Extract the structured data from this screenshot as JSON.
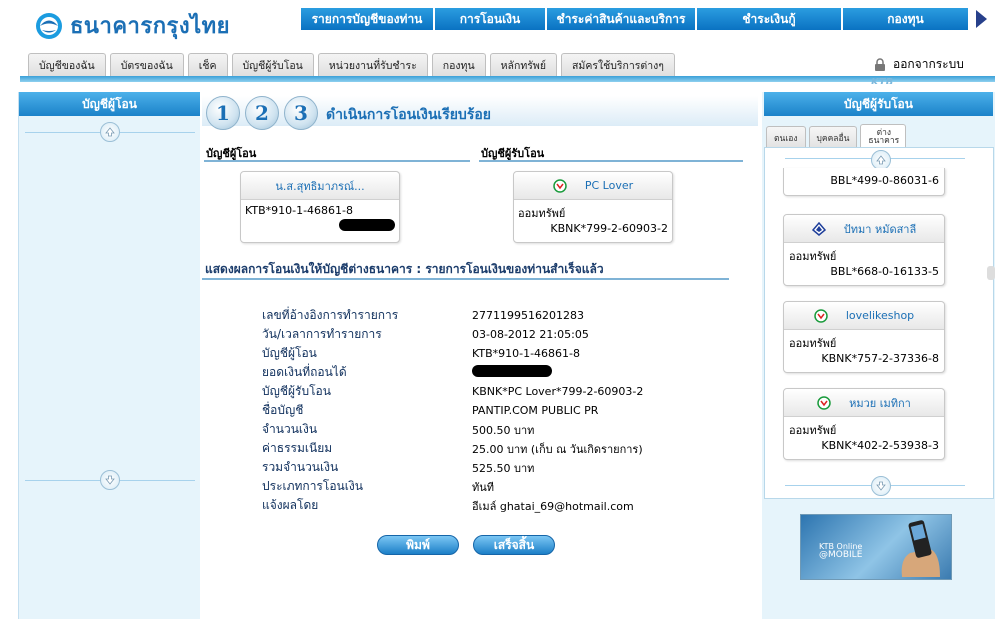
{
  "brand": {
    "name": "ธนาคารกรุงไทย"
  },
  "topnav": [
    {
      "label": "รายการบัญชีของท่าน",
      "width": 134
    },
    {
      "label": "การโอนเงิน",
      "width": 112
    },
    {
      "label": "ชำระค่าสินค้าและบริการ",
      "width": 150
    },
    {
      "label": "ชำระเงินกู้",
      "width": 146
    },
    {
      "label": "กองทุน",
      "width": 127
    }
  ],
  "subtabs": [
    "บัญชีของฉัน",
    "บัตรของฉัน",
    "เช็ค",
    "บัญชีผู้รับโอน",
    "หน่วยงานที่รับชำระ",
    "กองทุน",
    "หลักทรัพย์",
    "สมัครใช้บริการต่างๆ"
  ],
  "logout_label": "ออกจากระบบ",
  "ktb_mark": "KTB",
  "left_panel": {
    "title": "บัญชีผู้โอน"
  },
  "steps": [
    "1",
    "2",
    "3"
  ],
  "step_title": "ดำเนินการโอนเงินเรียบร้อย",
  "from_col_label": "บัญชีผู้โอน",
  "to_col_label": "บัญชีผู้รับโอน",
  "from_card": {
    "name": "น.ส.สุทธิมาภรณ์...",
    "account": "KTB*910-1-46861-8"
  },
  "to_card": {
    "name": "PC Lover",
    "type": "ออมทรัพย์",
    "account": "KBNK*799-2-60903-2"
  },
  "summary": "แสดงผลการโอนเงินให้บัญชีต่างธนาคาร   :   รายการโอนเงินของท่านสำเร็จแล้ว",
  "details": [
    {
      "label": "เลขที่อ้างอิงการทำรายการ",
      "value": "2771199516201283"
    },
    {
      "label": "วัน/เวลาการทำรายการ",
      "value": "03-08-2012 21:05:05"
    },
    {
      "label": "บัญชีผู้โอน",
      "value": "KTB*910-1-46861-8"
    },
    {
      "label": "ยอดเงินที่ถอนได้",
      "value": ""
    },
    {
      "label": "บัญชีผู้รับโอน",
      "value": "KBNK*PC Lover*799-2-60903-2"
    },
    {
      "label": "ชื่อบัญชี",
      "value": "PANTIP.COM PUBLIC PR"
    },
    {
      "label": "จำนวนเงิน",
      "value": "500.50 บาท"
    },
    {
      "label": "ค่าธรรมเนียม",
      "value": "25.00 บาท (เก็บ ณ วันเกิดรายการ)"
    },
    {
      "label": "รวมจำนวนเงิน",
      "value": "525.50 บาท"
    },
    {
      "label": "ประเภทการโอนเงิน",
      "value": "ทันที"
    },
    {
      "label": "แจ้งผลโดย",
      "value": "อีเมล์   ghatai_69@hotmail.com"
    }
  ],
  "buttons": {
    "print": "พิมพ์",
    "finish": "เสร็จสิ้น"
  },
  "right_panel": {
    "title": "บัญชีผู้รับโอน",
    "tabs": [
      "ตนเอง",
      "บุคคลอื่น",
      "ต่าง ธนาคาร"
    ],
    "partial_account": "BBL*499-0-86031-6",
    "cards": [
      {
        "name": "ปัทมา หมัดสาลี",
        "bank_icon": "bbl-icon",
        "type": "ออมทรัพย์",
        "account": "BBL*668-0-16133-5"
      },
      {
        "name": "lovelikeshop",
        "bank_icon": "kbank-icon",
        "type": "ออมทรัพย์",
        "account": "KBNK*757-2-37336-8"
      },
      {
        "name": "หมวย เมทิกา",
        "bank_icon": "kbank-icon",
        "type": "ออมทรัพย์",
        "account": "KBNK*402-2-53938-3"
      }
    ]
  },
  "promo": {
    "line1": "KTB Online",
    "line2": "@MOBILE"
  },
  "colors": {
    "brand_blue": "#1b6fb5",
    "nav_blue": "#0a72c2",
    "panel_bg": "#e6f4fb",
    "kbank_green": "#1a9b3c",
    "bbl_blue": "#1f3f9a"
  }
}
